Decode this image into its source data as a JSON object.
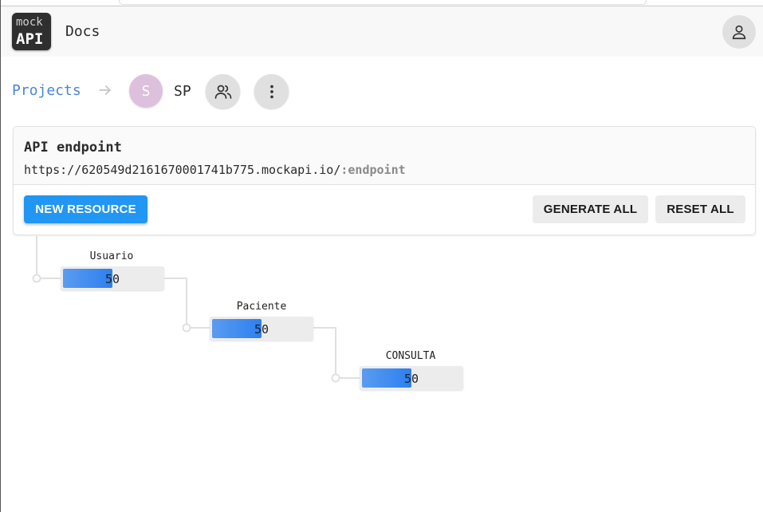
{
  "header": {
    "logo_top": "mock",
    "logo_bottom": "API",
    "docs_label": "Docs",
    "account_icon": "person-icon"
  },
  "breadcrumb": {
    "projects_label": "Projects",
    "arrow_icon": "arrow-right-icon",
    "avatar_letter": "S",
    "project_name": "SP",
    "members_icon": "people-icon",
    "menu_icon": "more-vertical-icon"
  },
  "endpoint_card": {
    "title": "API endpoint",
    "url_base": "https://620549d2161670001741b775.mockapi.io/",
    "url_suffix": ":endpoint",
    "new_resource_label": "NEW RESOURCE",
    "generate_all_label": "GENERATE ALL",
    "reset_all_label": "RESET ALL"
  },
  "resources": [
    {
      "name": "Usuario",
      "count": "50",
      "fill_fraction": 0.5
    },
    {
      "name": "Paciente",
      "count": "50",
      "fill_fraction": 0.5
    },
    {
      "name": "CONSULTA",
      "count": "50",
      "fill_fraction": 0.5
    }
  ],
  "colors": {
    "primary": "#2196f3",
    "link": "#4a86d6",
    "bar_fill": "#3a8af0",
    "avatar": "#dcc0dc"
  }
}
